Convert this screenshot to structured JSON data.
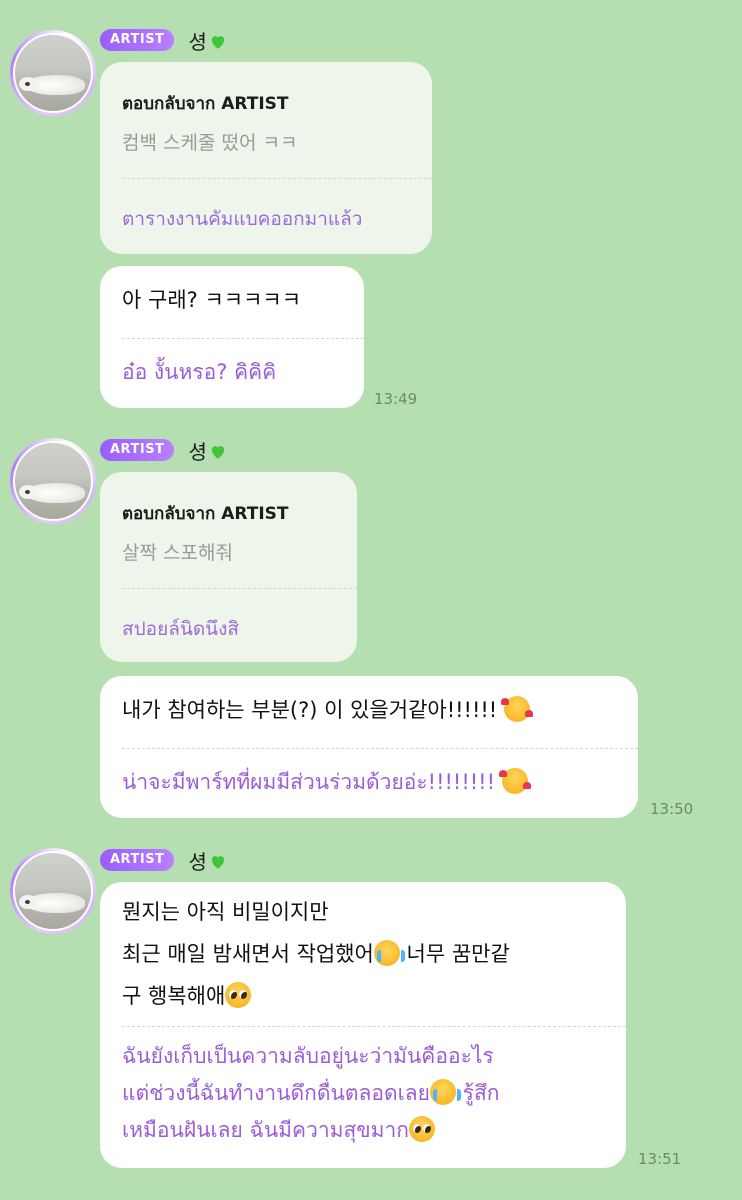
{
  "messages": [
    {
      "badge": "ARTIST",
      "sender": "셩",
      "heart_icon": "green-heart-icon",
      "reply": {
        "header": "ตอบกลับจาก ARTIST",
        "original": "컴백 스케줄 떴어 ㅋㅋ",
        "translation": "ตารางงานคัมแบคออกมาแล้ว"
      },
      "main": {
        "ko": "아 구래? ㅋㅋㅋㅋㅋ",
        "th": "อ๋อ งั้นหรอ? คิคิคิ"
      },
      "time": "13:49"
    },
    {
      "badge": "ARTIST",
      "sender": "셩",
      "heart_icon": "green-heart-icon",
      "reply": {
        "header": "ตอบกลับจาก ARTIST",
        "original": "살짝 스포해줘",
        "translation": "สปอยล์นิดนึงสิ"
      },
      "main": {
        "ko": "내가 참여하는 부분(?) 이 있을거같아!!!!!! ",
        "ko_emoji": "smiling-face-with-hearts-icon",
        "th": "น่าจะมีพาร์ทที่ผมมีส่วนร่วมด้วยอ่ะ!!!!!!!! ",
        "th_emoji": "smiling-face-with-hearts-icon"
      },
      "time": "13:50"
    },
    {
      "badge": "ARTIST",
      "sender": "셩",
      "heart_icon": "green-heart-icon",
      "main": {
        "ko_line1": "뭔지는 아직 비밀이지만",
        "ko_line2": "최근 매일 밤새면서 작업했어",
        "ko_line2_tail": " 너무 꿈만같",
        "ko_line3": "구 행복해애",
        "th_line1": "ฉันยังเก็บเป็นความลับอยู่นะว่ามันคืออะไร",
        "th_line2": "แต่ช่วงนี้ฉันทำงานดึกดื่นตลอดเลย",
        "th_line2_tail": " รู้สึก",
        "th_line3": "เหมือนฝันเลย ฉันมีความสุขมาก"
      },
      "time": "13:51"
    }
  ]
}
